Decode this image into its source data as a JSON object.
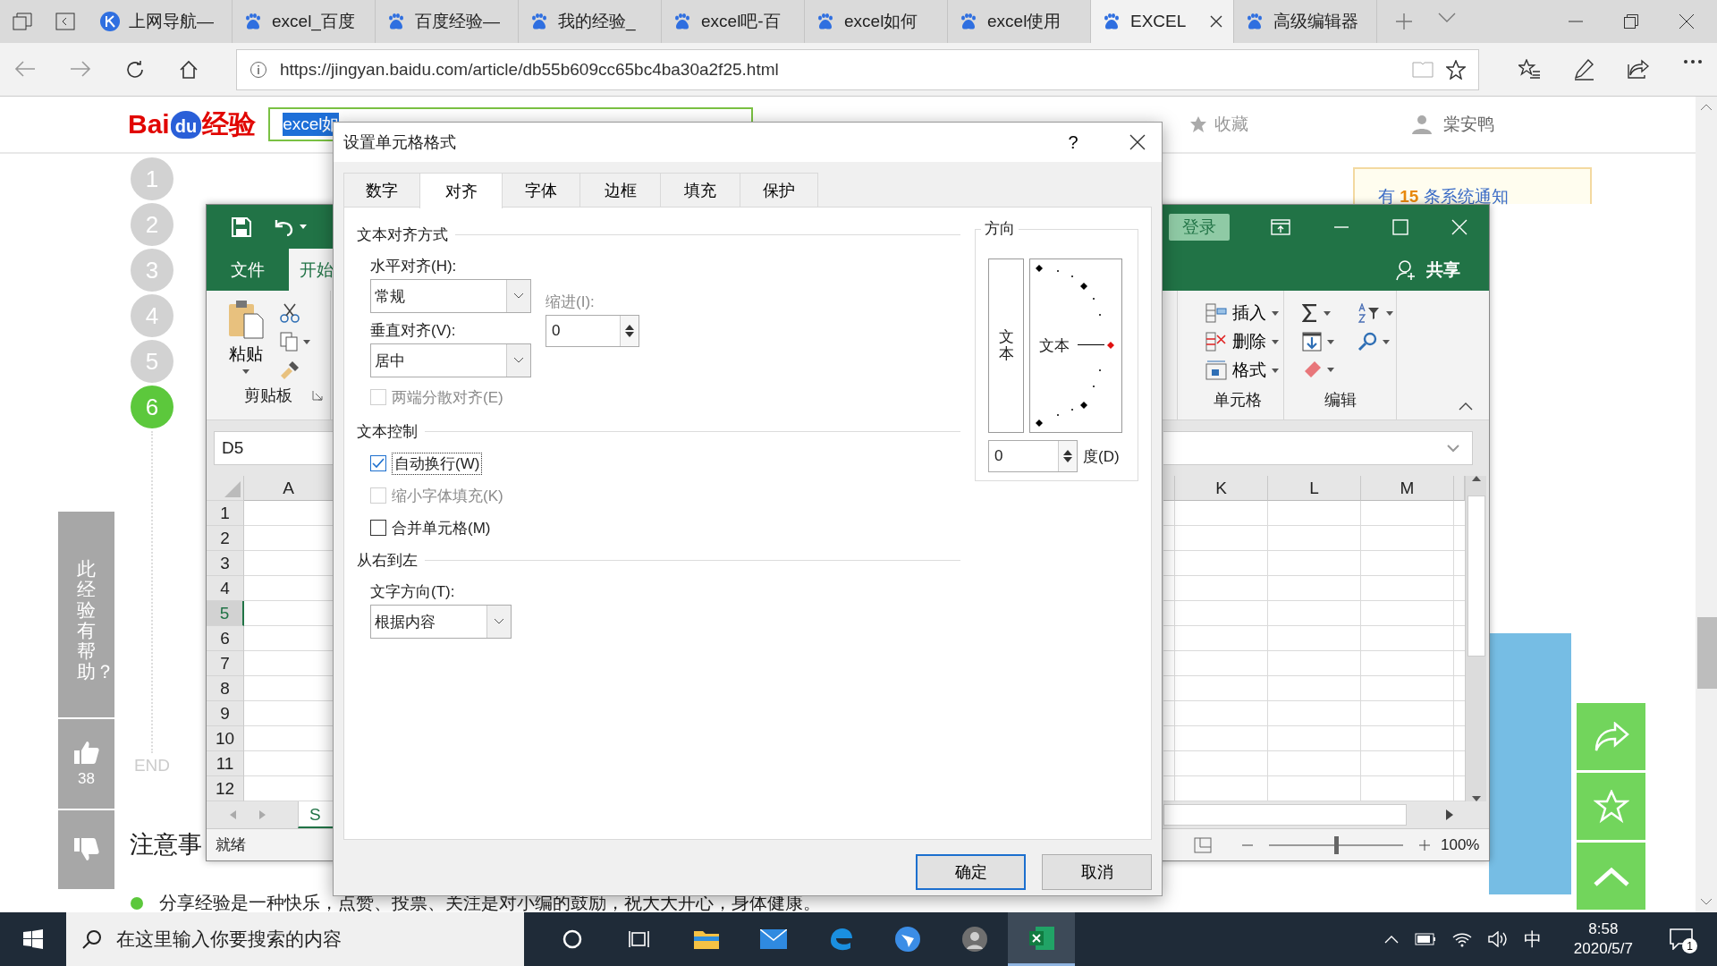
{
  "browser": {
    "tabs": [
      {
        "title": "上网导航—",
        "selected": false
      },
      {
        "title": "excel_百度",
        "selected": false
      },
      {
        "title": "百度经验—",
        "selected": false
      },
      {
        "title": "我的经验_",
        "selected": false
      },
      {
        "title": "excel吧-百",
        "selected": false
      },
      {
        "title": "excel如何",
        "selected": false
      },
      {
        "title": "excel使用",
        "selected": false
      },
      {
        "title": "EXCEL",
        "selected": true
      },
      {
        "title": "高级编辑器",
        "selected": false
      }
    ],
    "address": "https://jingyan.baidu.com/article/db55b609cc65bc4ba30a2f25.html"
  },
  "page": {
    "logo": [
      "Bai",
      "du",
      "经验"
    ],
    "search_text": "excel如",
    "favorite": "收藏",
    "user": "棠安鸭",
    "notice": "有 **15** 条系统通知",
    "steps": [
      {
        "label": "1",
        "selected": false
      },
      {
        "label": "2",
        "selected": false
      },
      {
        "label": "3",
        "selected": false
      },
      {
        "label": "4",
        "selected": false
      },
      {
        "label": "5",
        "selected": false
      },
      {
        "label": "6",
        "selected": true
      }
    ],
    "end": "END",
    "section_title": "注意事",
    "bullet": "分享经验是一种快乐，点赞、投票、关注是对小编的鼓励，祝大大开心，身体健康。",
    "feedback": {
      "question": "此经验有帮助？",
      "likes": "38"
    }
  },
  "excel": {
    "login": "登录",
    "tabs": [
      {
        "label": "文件",
        "selected": false
      },
      {
        "label": "开始",
        "selected": true
      }
    ],
    "share": "共享",
    "paste": "粘贴",
    "clipboard_group": "剪贴板",
    "cell_actions": [
      "插入",
      "删除",
      "格式"
    ],
    "cells_group": "单元格",
    "editing_group": "编辑",
    "name_box": "D5",
    "left_columns": [
      "A"
    ],
    "right_columns": [
      "K",
      "L",
      "M"
    ],
    "rows": [
      {
        "label": "1",
        "selected": false
      },
      {
        "label": "2",
        "selected": false
      },
      {
        "label": "3",
        "selected": false
      },
      {
        "label": "4",
        "selected": false
      },
      {
        "label": "5",
        "selected": true
      },
      {
        "label": "6",
        "selected": false
      },
      {
        "label": "7",
        "selected": false
      },
      {
        "label": "8",
        "selected": false
      },
      {
        "label": "9",
        "selected": false
      },
      {
        "label": "10",
        "selected": false
      },
      {
        "label": "11",
        "selected": false
      },
      {
        "label": "12",
        "selected": false
      }
    ],
    "sheet_tab": "S",
    "status": "就绪",
    "zoom_slider": {
      "level": 0.5
    },
    "zoom": "100%"
  },
  "dialog": {
    "title": "设置单元格格式",
    "help": "?",
    "tabs": [
      {
        "label": "数字",
        "selected": false
      },
      {
        "label": "对齐",
        "selected": true
      },
      {
        "label": "字体",
        "selected": false
      },
      {
        "label": "边框",
        "selected": false
      },
      {
        "label": "填充",
        "selected": false
      },
      {
        "label": "保护",
        "selected": false
      }
    ],
    "alignment": {
      "heading": "文本对齐方式",
      "horizontal_label": "水平对齐(H):",
      "horizontal_value": "常规",
      "indent_label": "缩进(I):",
      "indent_value": "0",
      "vertical_label": "垂直对齐(V):",
      "vertical_value": "居中",
      "distributed": {
        "label": "两端分散对齐(E)",
        "checked": false,
        "disabled": true
      }
    },
    "text_control": {
      "heading": "文本控制",
      "options": [
        {
          "label": "自动换行(W)",
          "checked": true,
          "disabled": false
        },
        {
          "label": "缩小字体填充(K)",
          "checked": false,
          "disabled": true
        },
        {
          "label": "合并单元格(M)",
          "checked": false,
          "disabled": false
        }
      ]
    },
    "rtl": {
      "heading": "从右到左",
      "direction_label": "文字方向(T):",
      "direction_value": "根据内容"
    },
    "orientation": {
      "heading": "方向",
      "vertical_text": "文本",
      "dial_text": "文本",
      "degrees_value": "0",
      "degrees_label": "度(D)"
    },
    "buttons": [
      {
        "label": "确定",
        "default": true
      },
      {
        "label": "取消",
        "default": false
      }
    ]
  },
  "taskbar": {
    "search_placeholder": "在这里输入你要搜索的内容",
    "apps": [
      {
        "kind": "cortana",
        "active": false
      },
      {
        "kind": "taskview",
        "active": false
      },
      {
        "kind": "explorer",
        "active": false
      },
      {
        "kind": "mail",
        "active": false
      },
      {
        "kind": "edge",
        "active": false
      },
      {
        "kind": "bird",
        "active": false
      },
      {
        "kind": "avatar",
        "active": false
      },
      {
        "kind": "excel",
        "active": true
      }
    ],
    "ime": "中",
    "time": "8:58",
    "date": "2020/5/7",
    "notifications": "1"
  }
}
